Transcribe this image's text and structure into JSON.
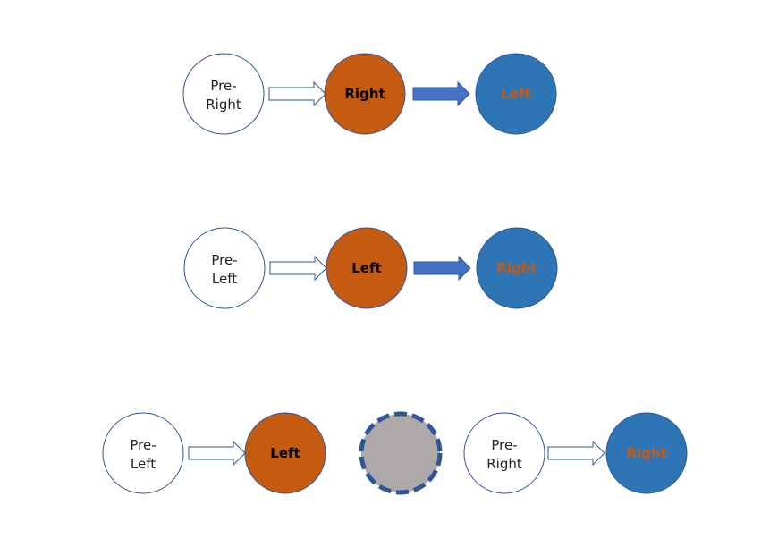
{
  "colors": {
    "outline": "#2F5597",
    "orange": "#C55A11",
    "blue": "#2E75B6",
    "arrow_fill": "#4472C4",
    "gray": "#ADA9A9",
    "dash": "#2F5597",
    "text_dark": "#000000",
    "text_light": "#222222",
    "text_orange": "#C55A11"
  },
  "rows": [
    {
      "pre": [
        "Pre-",
        "Right"
      ],
      "middle": "Right",
      "end": "Left"
    },
    {
      "pre": [
        "Pre-",
        "Left"
      ],
      "middle": "Left",
      "end": "Right"
    }
  ],
  "bottom": {
    "left_group": {
      "pre": [
        "Pre-",
        "Left"
      ],
      "target": "Left"
    },
    "right_group": {
      "pre": [
        "Pre-",
        "Right"
      ],
      "target": "Right"
    }
  }
}
